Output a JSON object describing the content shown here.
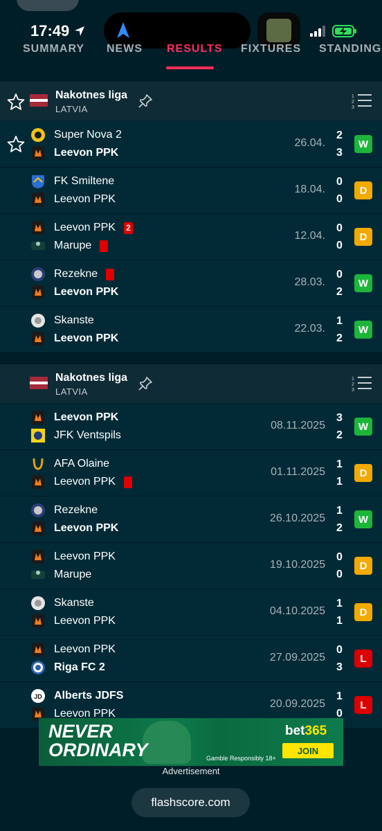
{
  "status_bar": {
    "time": "17:49"
  },
  "tabs": [
    {
      "label": "SUMMARY"
    },
    {
      "label": "NEWS"
    },
    {
      "label": "RESULTS"
    },
    {
      "label": "FIXTURES"
    },
    {
      "label": "STANDINGS"
    }
  ],
  "active_tab": "RESULTS",
  "groups": [
    {
      "league": "Nakotnes liga",
      "country": "LATVIA",
      "matches": [
        {
          "home": "Super Nova 2",
          "away": "Leevon PPK",
          "home_bold": false,
          "away_bold": true,
          "date": "26.04.",
          "home_score": "2",
          "away_score": "3",
          "result": "W",
          "starred": true
        },
        {
          "home": "FK Smiltene",
          "away": "Leevon PPK",
          "home_bold": false,
          "away_bold": false,
          "date": "18.04.",
          "home_score": "0",
          "away_score": "0",
          "result": "D"
        },
        {
          "home": "Leevon PPK",
          "away": "Marupe",
          "home_bold": false,
          "away_bold": false,
          "date": "12.04.",
          "home_score": "0",
          "away_score": "0",
          "result": "D",
          "home_redcards": "2",
          "away_redcard": true
        },
        {
          "home": "Rezekne",
          "away": "Leevon PPK",
          "home_bold": false,
          "away_bold": true,
          "date": "28.03.",
          "home_score": "0",
          "away_score": "2",
          "result": "W",
          "home_redcard": true
        },
        {
          "home": "Skanste",
          "away": "Leevon PPK",
          "home_bold": false,
          "away_bold": true,
          "date": "22.03.",
          "home_score": "1",
          "away_score": "2",
          "result": "W"
        }
      ]
    },
    {
      "league": "Nakotnes liga",
      "country": "LATVIA",
      "matches": [
        {
          "home": "Leevon PPK",
          "away": "JFK Ventspils",
          "home_bold": true,
          "away_bold": false,
          "date": "08.11.2025",
          "home_score": "3",
          "away_score": "2",
          "result": "W"
        },
        {
          "home": "AFA Olaine",
          "away": "Leevon PPK",
          "home_bold": false,
          "away_bold": false,
          "date": "01.11.2025",
          "home_score": "1",
          "away_score": "1",
          "result": "D",
          "away_redcard": true
        },
        {
          "home": "Rezekne",
          "away": "Leevon PPK",
          "home_bold": false,
          "away_bold": true,
          "date": "26.10.2025",
          "home_score": "1",
          "away_score": "2",
          "result": "W"
        },
        {
          "home": "Leevon PPK",
          "away": "Marupe",
          "home_bold": false,
          "away_bold": false,
          "date": "19.10.2025",
          "home_score": "0",
          "away_score": "0",
          "result": "D"
        },
        {
          "home": "Skanste",
          "away": "Leevon PPK",
          "home_bold": false,
          "away_bold": false,
          "date": "04.10.2025",
          "home_score": "1",
          "away_score": "1",
          "result": "D"
        },
        {
          "home": "Leevon PPK",
          "away": "Riga FC 2",
          "home_bold": false,
          "away_bold": true,
          "date": "27.09.2025",
          "home_score": "0",
          "away_score": "3",
          "result": "L"
        },
        {
          "home": "Alberts JDFS",
          "away": "Leevon PPK",
          "home_bold": true,
          "away_bold": false,
          "date": "20.09.2025",
          "home_score": "1",
          "away_score": "0",
          "result": "L"
        }
      ]
    }
  ],
  "ad": {
    "headline_1": "NEVER",
    "headline_2": "ORDINARY",
    "brand_a": "bet",
    "brand_b": "365",
    "join": "JOIN",
    "gamble": "Gamble Responsibly  18+",
    "caption": "Advertisement"
  },
  "url": "flashscore.com",
  "colors": {
    "background": "#001e28",
    "accent": "#ff2d5c",
    "win": "#1db53a",
    "draw": "#f2a900",
    "loss": "#dc0000"
  }
}
